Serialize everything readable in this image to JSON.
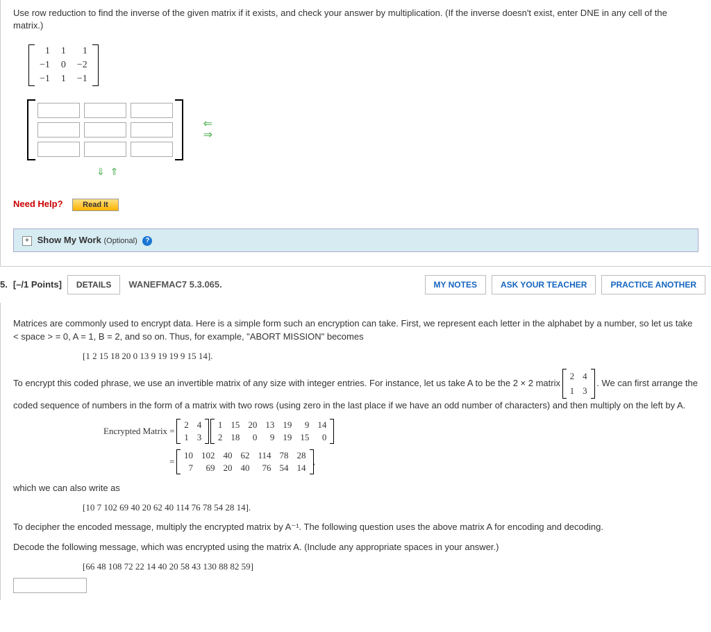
{
  "q4": {
    "instructions": "Use row reduction to find the inverse of the given matrix if it exists, and check your answer by multiplication. (If the inverse doesn't exist, enter DNE in any cell of the matrix.)",
    "matrix": [
      [
        "1",
        "1",
        "1"
      ],
      [
        "−1",
        "0",
        "−2"
      ],
      [
        "−1",
        "1",
        "−1"
      ]
    ],
    "needHelpLabel": "Need Help?",
    "readIt": "Read It",
    "showMyWork": "Show My Work",
    "optional": "(Optional)"
  },
  "q5": {
    "number": "5.",
    "points": "[–/1 Points]",
    "details": "DETAILS",
    "bookRef": "WANEFMAC7 5.3.065.",
    "myNotes": "MY NOTES",
    "askTeacher": "ASK YOUR TEACHER",
    "practice": "PRACTICE ANOTHER",
    "para1": "Matrices are commonly used to encrypt data. Here is a simple form such an encryption can take. First, we represent each letter in the alphabet by a number, so let us take < space > = 0, A = 1, B = 2, and so on. Thus, for example, \"ABORT MISSION\" becomes",
    "coded1": "[1  2  15  18  20  0  13  9  19  19  9  15  14].",
    "para2a": "To encrypt this coded phrase, we use an invertible matrix of any size with integer entries. For instance, let us take A to be the 2 × 2 matrix ",
    "para2b": ". We can first arrange the coded sequence of numbers in the form of a matrix with two rows (using zero in the last place if we have an odd number of characters) and then multiply on the left by A.",
    "matrixA": [
      [
        "2",
        "4"
      ],
      [
        "1",
        "3"
      ]
    ],
    "encLabel": "Encrypted Matrix  =",
    "encM1": [
      [
        "2",
        "4"
      ],
      [
        "1",
        "3"
      ]
    ],
    "encM2": [
      [
        "1",
        "15",
        "20",
        "13",
        "19",
        "9",
        "14"
      ],
      [
        "2",
        "18",
        "0",
        "9",
        "19",
        "15",
        "0"
      ]
    ],
    "encEq2": "=",
    "encM3": [
      [
        "10",
        "102",
        "40",
        "62",
        "114",
        "78",
        "28"
      ],
      [
        "7",
        "69",
        "20",
        "40",
        "76",
        "54",
        "14"
      ]
    ],
    "encComma": ",",
    "para3": "which we can also write as",
    "coded2": "[10  7  102  69  40  20  62  40  114  76  78  54  28  14].",
    "para4": "To decipher the encoded message, multiply the encrypted matrix by A⁻¹. The following question uses the above matrix A for encoding and decoding.",
    "para5": "Decode the following message, which was encrypted using the matrix A. (Include any appropriate spaces in your answer.)",
    "coded3": "[66  48  108  72  22  14  40  20  58  43  130  88  82  59]"
  }
}
